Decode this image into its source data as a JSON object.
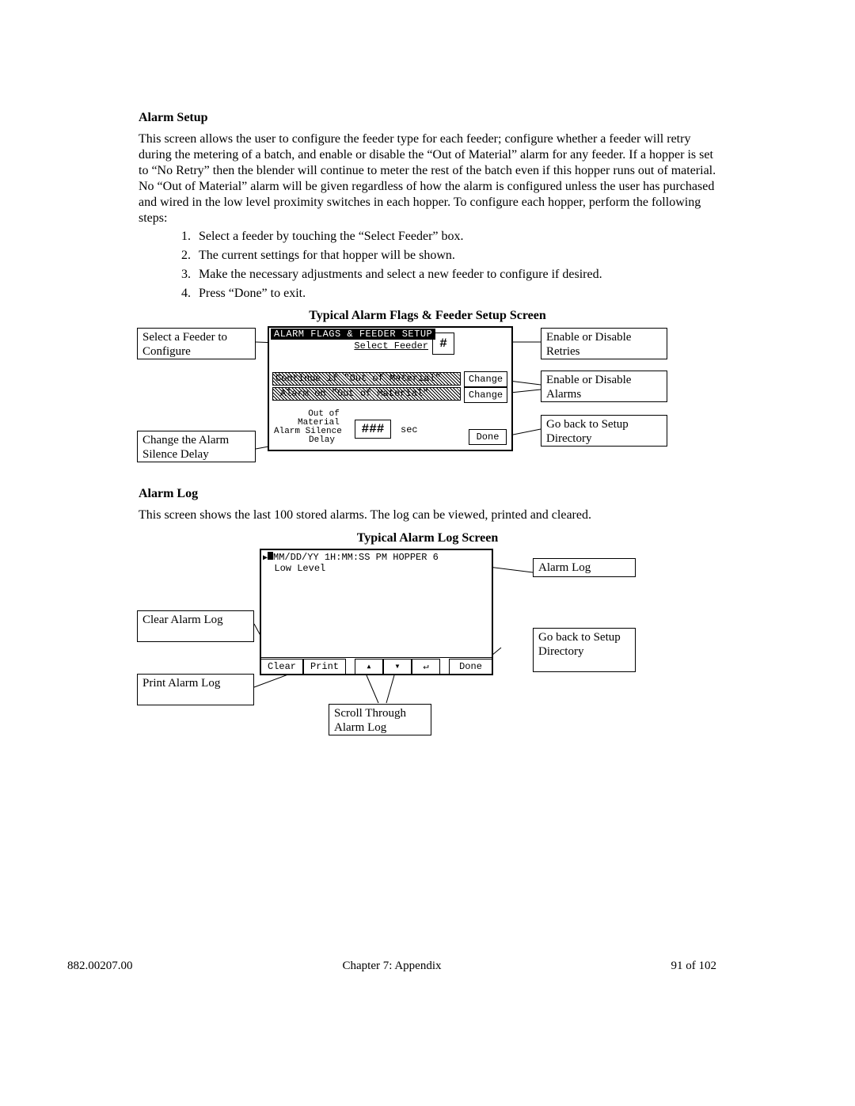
{
  "section1": {
    "title": "Alarm Setup",
    "para": "This screen allows the user to configure the feeder type for each feeder; configure whether a feeder will retry during the metering of a batch, and enable or disable the “Out of Material” alarm for any feeder.  If a hopper is set to “No Retry” then the blender will continue to meter the rest of the batch even if this hopper runs out of material.  No “Out of Material” alarm will be given regardless of how the alarm is configured unless the user has purchased and wired in the low level proximity switches in each hopper.  To configure each hopper, perform the following steps:",
    "steps": [
      "Select a feeder by touching the “Select Feeder” box.",
      "The current settings for that hopper will be shown.",
      "Make the necessary adjustments and select a new feeder to configure if desired.",
      "Press “Done” to exit."
    ],
    "caption": "Typical Alarm Flags & Feeder Setup Screen",
    "ann_select": "Select a Feeder to Configure",
    "ann_retries": "Enable or Disable Retries",
    "ann_alarms": "Enable or Disable Alarms",
    "ann_back": "Go back to Setup Directory",
    "ann_delay": "Change the Alarm Silence Delay",
    "hmi_title": "ALARM FLAGS & FEEDER SETUP",
    "select_feeder": "Select Feeder",
    "feeder_num": "#",
    "row1": "Continue if \"Out of Material\"",
    "row2": "Alarm on \"Out of Material\"",
    "change": "Change",
    "delay_label1": "Out of",
    "delay_label2": "Material",
    "delay_label3": "Alarm Silence",
    "delay_label4": "Delay",
    "delay_val": "###",
    "sec": "sec",
    "done": "Done"
  },
  "section2": {
    "title": "Alarm Log",
    "para": "This screen shows the last 100 stored alarms.  The log can be viewed, printed and cleared.",
    "caption": "Typical Alarm Log Screen",
    "ann_clear": "Clear Alarm Log",
    "ann_print": "Print Alarm Log",
    "ann_scroll": "Scroll Through Alarm Log",
    "ann_log": "Alarm Log",
    "ann_back": "Go back to Setup Directory",
    "log_line1": "MM/DD/YY 1H:MM:SS PM HOPPER 6",
    "log_line2": "Low Level",
    "btn_clear": "Clear",
    "btn_print": "Print",
    "btn_up": "▴",
    "btn_down": "▾",
    "btn_ack": "↵",
    "btn_done": "Done"
  },
  "footer": {
    "docnum": "882.00207.00",
    "chapter": "Chapter 7: Appendix",
    "page": "91 of 102"
  }
}
